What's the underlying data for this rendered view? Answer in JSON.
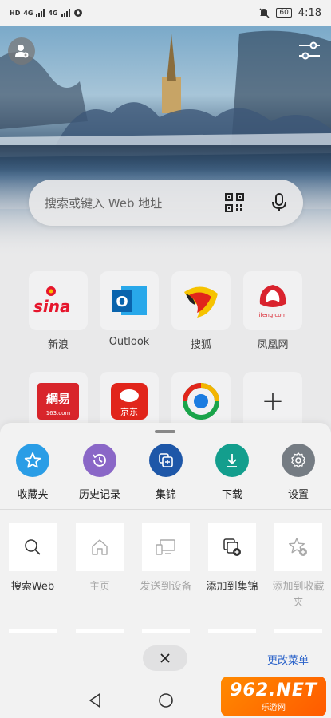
{
  "status_bar": {
    "sim_labels": [
      "HD",
      "4G",
      "4G"
    ],
    "battery": "60",
    "time": "4:18"
  },
  "search": {
    "placeholder": "搜索或键入 Web 地址",
    "qr_icon": "qr-scan-icon",
    "mic_icon": "microphone-icon"
  },
  "speed_dial": [
    {
      "label": "新浪",
      "logo_text": "sina"
    },
    {
      "label": "Outlook",
      "logo_text": "O"
    },
    {
      "label": "搜狐",
      "logo_text": ""
    },
    {
      "label": "凤凰网",
      "logo_text": "ifeng.com"
    },
    {
      "label": "",
      "logo_text": "網易",
      "sub": "163.com"
    },
    {
      "label": "",
      "logo_text": "京东"
    },
    {
      "label": "",
      "logo_text": ""
    },
    {
      "label": "",
      "logo_text": "+"
    }
  ],
  "sheet": {
    "quick_actions": [
      {
        "label": "收藏夹",
        "icon": "star-icon",
        "color": "#2a9de6"
      },
      {
        "label": "历史记录",
        "icon": "history-icon",
        "color": "#8a67c7"
      },
      {
        "label": "集锦",
        "icon": "collections-icon",
        "color": "#1e57a8"
      },
      {
        "label": "下载",
        "icon": "download-icon",
        "color": "#139e8d"
      },
      {
        "label": "设置",
        "icon": "gear-icon",
        "color": "#757c83"
      }
    ],
    "grid": [
      {
        "label": "搜索Web",
        "icon": "search-icon"
      },
      {
        "label": "主页",
        "icon": "home-icon"
      },
      {
        "label": "发送到设备",
        "icon": "send-to-device-icon"
      },
      {
        "label": "添加到集锦",
        "icon": "add-to-collection-icon"
      },
      {
        "label": "添加到收藏",
        "label2": "夹",
        "icon": "add-favorite-icon"
      }
    ],
    "close_icon": "close-icon",
    "edit_menu": "更改菜单"
  },
  "watermark": {
    "brand": "962.NET",
    "sub": "乐游网"
  },
  "colors": {
    "accent_link": "#2a62c9",
    "sheet_bg": "#f2f2f2",
    "page_bg": "#e9e9ea"
  }
}
